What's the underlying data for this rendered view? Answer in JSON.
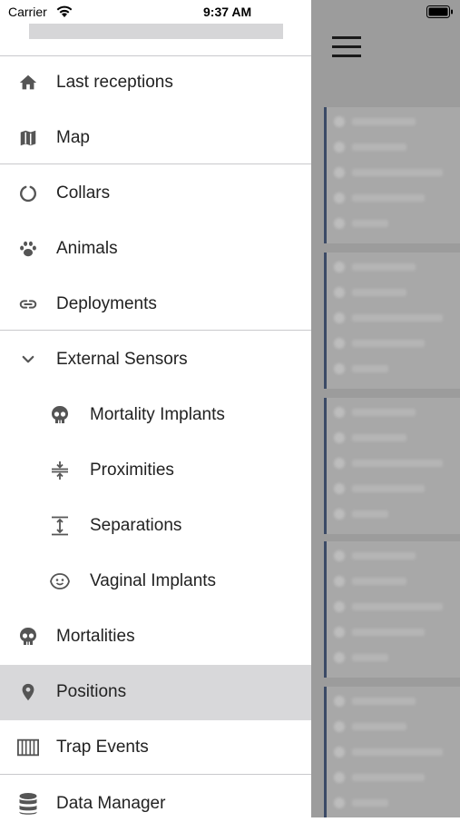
{
  "status_bar": {
    "carrier": "Carrier",
    "time": "9:37 AM"
  },
  "drawer": {
    "items": [
      {
        "label": "Last receptions",
        "icon": "home-icon"
      },
      {
        "label": "Map",
        "icon": "map-icon"
      },
      {
        "label": "Collars",
        "icon": "collar-ring-icon"
      },
      {
        "label": "Animals",
        "icon": "paw-icon"
      },
      {
        "label": "Deployments",
        "icon": "link-icon"
      },
      {
        "label": "External Sensors",
        "icon": "chevron-down-icon"
      },
      {
        "label": "Mortality Implants",
        "icon": "skull-icon"
      },
      {
        "label": "Proximities",
        "icon": "proximity-icon"
      },
      {
        "label": "Separations",
        "icon": "separation-icon"
      },
      {
        "label": "Vaginal Implants",
        "icon": "face-icon"
      },
      {
        "label": "Mortalities",
        "icon": "skull-icon"
      },
      {
        "label": "Positions",
        "icon": "location-pin-icon",
        "active": true
      },
      {
        "label": "Trap Events",
        "icon": "trap-icon"
      },
      {
        "label": "Data Manager",
        "icon": "database-icon"
      }
    ]
  },
  "colors": {
    "drawer_bg": "#ffffff",
    "active_bg": "#d8d8da",
    "scrim": "#9c9c9c",
    "card_accent": "#3b4a66"
  }
}
